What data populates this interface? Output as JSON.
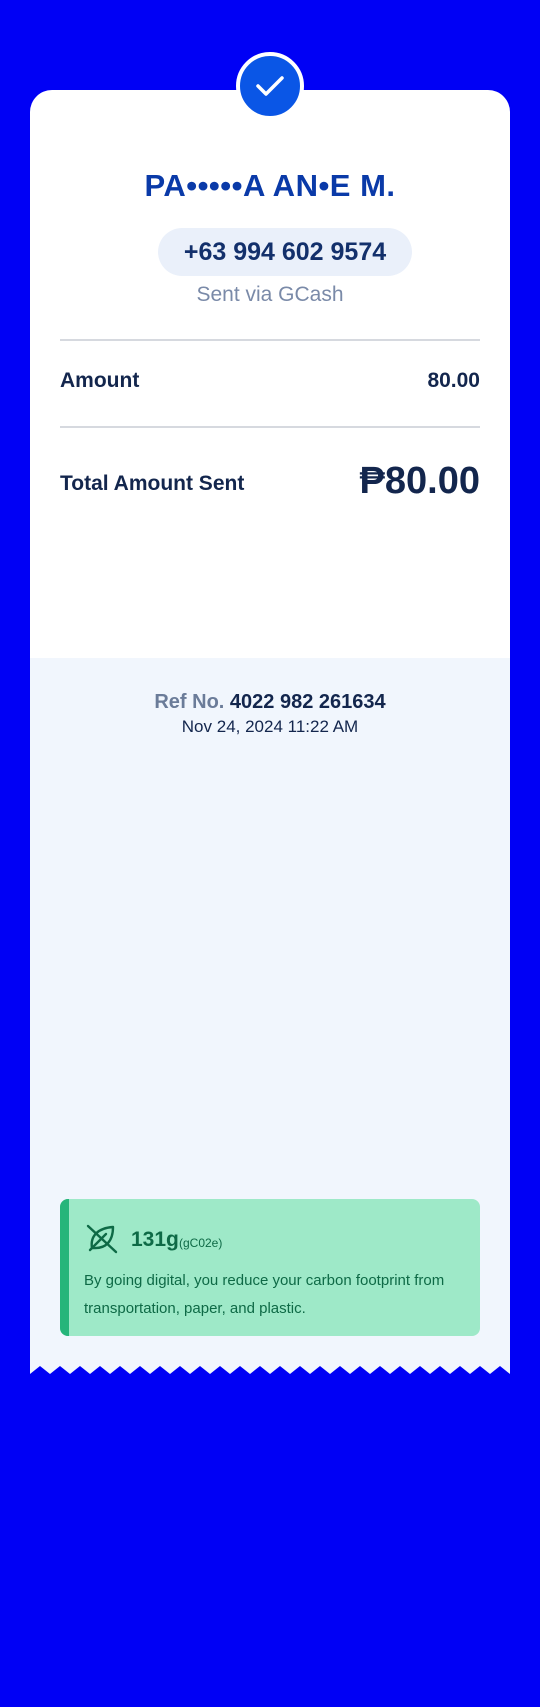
{
  "recipient": {
    "name": "PA•••••A AN•E M.",
    "phone": "+63 994 602 9574",
    "method": "Sent via GCash"
  },
  "summary": {
    "amount_label": "Amount",
    "amount_value": "80.00",
    "total_label": "Total Amount Sent",
    "total_value": "₱80.00"
  },
  "reference": {
    "label": "Ref No.",
    "number": "4022 982 261634",
    "datetime": "Nov 24, 2024 11:22 AM"
  },
  "carbon": {
    "amount": "131g",
    "unit": "(gC02e)",
    "message": "By going digital, you reduce your carbon footprint from transportation, paper, and plastic.",
    "icon": "leaf-icon"
  },
  "colors": {
    "background": "#0000f5",
    "brand_blue": "#0a56e6",
    "name_blue": "#0a3aa8",
    "text_dark": "#13264d",
    "carbon_green_bg": "#9ee9c8",
    "carbon_green_text": "#0e6a46"
  }
}
